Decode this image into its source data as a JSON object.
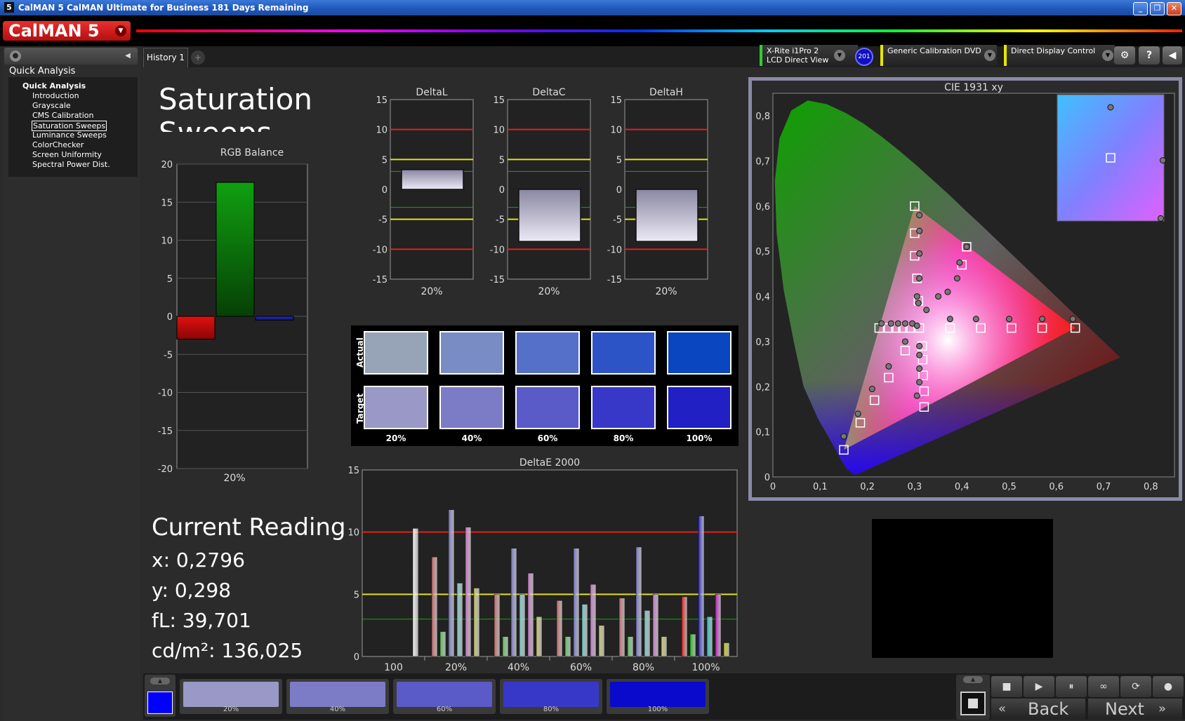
{
  "window": {
    "title": "CalMAN 5 CalMAN Ultimate for Business 181 Days Remaining",
    "logo_text": "CalMAN 5",
    "controls": [
      "_",
      "❐",
      "✕"
    ]
  },
  "sidebar": {
    "section_label": "Quick Analysis",
    "tree_head": "Quick Analysis",
    "items": [
      {
        "label": "Introduction",
        "selected": false
      },
      {
        "label": "Grayscale",
        "selected": false
      },
      {
        "label": "CMS Calibration",
        "selected": false
      },
      {
        "label": "Saturation Sweeps",
        "selected": true
      },
      {
        "label": "Luminance Sweeps",
        "selected": false
      },
      {
        "label": "ColorChecker",
        "selected": false
      },
      {
        "label": "Screen Uniformity",
        "selected": false
      },
      {
        "label": "Spectral Power Dist.",
        "selected": false
      }
    ]
  },
  "tabs": [
    {
      "label": "History 1"
    }
  ],
  "tab_add": "+",
  "devices": {
    "meter_line1": "X-Rite i1Pro 2",
    "meter_line2": "LCD Direct View",
    "meter_badge": "201",
    "source": "Generic Calibration DVD",
    "display": "Direct Display Control",
    "meter_color": "#33cc33",
    "source_color": "#e6e600",
    "display_color": "#e6e600"
  },
  "page": {
    "title_line1": "Saturation",
    "title_line2": "Sweeps"
  },
  "rgb_balance": {
    "title": "RGB Balance",
    "ymin": -20,
    "ymax": 20,
    "yticks": [
      20,
      15,
      10,
      5,
      0,
      -5,
      -10,
      -15,
      -20
    ],
    "xlabel": "20%",
    "bars": [
      {
        "name": "R",
        "value": -3,
        "color": "#e01010"
      },
      {
        "name": "G",
        "value": 17.6,
        "color": "#10a010"
      },
      {
        "name": "B",
        "value": -0.5,
        "color": "#2030d0"
      }
    ]
  },
  "delta_charts": [
    {
      "title": "DeltaL",
      "value": 3.3,
      "xlabel": "20%"
    },
    {
      "title": "DeltaC",
      "value": -8.7,
      "xlabel": "20%"
    },
    {
      "title": "DeltaH",
      "value": -8.7,
      "xlabel": "20%"
    }
  ],
  "delta_axis": {
    "ymin": -15,
    "ymax": 15,
    "yticks": [
      15,
      10,
      5,
      0,
      -5,
      -10,
      -15
    ],
    "lines": [
      {
        "y": 10,
        "color": "#e02020"
      },
      {
        "y": 5,
        "color": "#e0e020"
      },
      {
        "y": 3,
        "color": "#20a020"
      },
      {
        "y": -3,
        "color": "#20a020"
      },
      {
        "y": -5,
        "color": "#e0e020"
      },
      {
        "y": -10,
        "color": "#e02020"
      }
    ]
  },
  "swatches": {
    "actual_label": "Actual",
    "target_label": "Target",
    "labels": [
      "20%",
      "40%",
      "60%",
      "80%",
      "100%"
    ],
    "actual_colors": [
      "#97a4b8",
      "#7a8cc4",
      "#5570c8",
      "#2c54c6",
      "#0a46c0"
    ],
    "target_colors": [
      "#9a98c6",
      "#7c7cc6",
      "#5a5ac8",
      "#3838c8",
      "#2020c4"
    ]
  },
  "current_reading": {
    "title": "Current Reading",
    "x": "x: 0,2796",
    "y": "y: 0,298",
    "fl": "fL: 39,701",
    "cdm2": "cd/m²: 136,025"
  },
  "chart_data": [
    {
      "type": "bar",
      "title": "DeltaE 2000",
      "categories": [
        "100",
        "20%",
        "40%",
        "60%",
        "80%",
        "100%"
      ],
      "ylim": [
        0,
        15
      ],
      "yticks": [
        15,
        10,
        5,
        0
      ],
      "series": [
        {
          "values": [
            10.3,
            8,
            5,
            4.5,
            4.7,
            4.8
          ],
          "color": "#c06060"
        },
        {
          "values": [
            null,
            2,
            1.6,
            1.6,
            1.6,
            1.8
          ],
          "color": "#50c050"
        },
        {
          "values": [
            null,
            11.8,
            8.7,
            8.7,
            8.8,
            11.3
          ],
          "color": "#7070c0"
        },
        {
          "values": [
            null,
            5.9,
            5,
            4.2,
            3.7,
            3.2
          ],
          "color": "#70c0c0"
        },
        {
          "values": [
            null,
            10.4,
            6.7,
            5.8,
            5,
            5
          ],
          "color": "#c070c0"
        },
        {
          "values": [
            null,
            5.5,
            3.2,
            2.5,
            1.6,
            1.1
          ],
          "color": "#c0c060"
        }
      ],
      "threshold_lines": [
        {
          "y": 10,
          "color": "#e02020"
        },
        {
          "y": 5,
          "color": "#e0e020"
        },
        {
          "y": 3,
          "color": "#20a020"
        }
      ]
    },
    {
      "type": "scatter",
      "title": "CIE 1931 xy",
      "xlim": [
        0,
        0.85
      ],
      "ylim": [
        0,
        0.85
      ],
      "xticks": [
        "0",
        "0,1",
        "0,2",
        "0,3",
        "0,4",
        "0,5",
        "0,6",
        "0,7",
        "0,8"
      ],
      "yticks": [
        "0,8",
        "0,7",
        "0,6",
        "0,5",
        "0,4",
        "0,3",
        "0,2",
        "0,1",
        "0"
      ],
      "target_gamut": [
        [
          0.64,
          0.33
        ],
        [
          0.3,
          0.6
        ],
        [
          0.15,
          0.06
        ]
      ],
      "white_point": [
        0.3127,
        0.329
      ],
      "series": [
        {
          "name": "targets",
          "points": [
            [
              0.64,
              0.33
            ],
            [
              0.57,
              0.33
            ],
            [
              0.505,
              0.33
            ],
            [
              0.44,
              0.33
            ],
            [
              0.375,
              0.33
            ],
            [
              0.3,
              0.6
            ],
            [
              0.3,
              0.54
            ],
            [
              0.3,
              0.49
            ],
            [
              0.305,
              0.44
            ],
            [
              0.308,
              0.39
            ],
            [
              0.41,
              0.51
            ],
            [
              0.4,
              0.47
            ],
            [
              0.15,
              0.06
            ],
            [
              0.185,
              0.12
            ],
            [
              0.215,
              0.17
            ],
            [
              0.245,
              0.22
            ],
            [
              0.28,
              0.28
            ],
            [
              0.32,
              0.155
            ],
            [
              0.32,
              0.19
            ],
            [
              0.318,
              0.225
            ],
            [
              0.317,
              0.26
            ],
            [
              0.316,
              0.29
            ],
            [
              0.225,
              0.33
            ],
            [
              0.245,
              0.33
            ],
            [
              0.26,
              0.33
            ],
            [
              0.275,
              0.33
            ],
            [
              0.29,
              0.33
            ],
            [
              0.31,
              0.33
            ]
          ]
        },
        {
          "name": "measured",
          "points": [
            [
              0.635,
              0.35
            ],
            [
              0.57,
              0.35
            ],
            [
              0.5,
              0.35
            ],
            [
              0.43,
              0.35
            ],
            [
              0.375,
              0.35
            ],
            [
              0.31,
              0.58
            ],
            [
              0.31,
              0.545
            ],
            [
              0.31,
              0.495
            ],
            [
              0.31,
              0.44
            ],
            [
              0.308,
              0.385
            ],
            [
              0.41,
              0.51
            ],
            [
              0.395,
              0.475
            ],
            [
              0.39,
              0.44
            ],
            [
              0.37,
              0.41
            ],
            [
              0.35,
              0.4
            ],
            [
              0.325,
              0.37
            ],
            [
              0.305,
              0.4
            ],
            [
              0.15,
              0.09
            ],
            [
              0.18,
              0.14
            ],
            [
              0.21,
              0.195
            ],
            [
              0.245,
              0.245
            ],
            [
              0.28,
              0.3
            ],
            [
              0.305,
              0.18
            ],
            [
              0.31,
              0.21
            ],
            [
              0.31,
              0.24
            ],
            [
              0.31,
              0.27
            ],
            [
              0.31,
              0.29
            ],
            [
              0.23,
              0.34
            ],
            [
              0.25,
              0.34
            ],
            [
              0.265,
              0.34
            ],
            [
              0.28,
              0.34
            ],
            [
              0.295,
              0.34
            ],
            [
              0.305,
              0.335
            ]
          ]
        }
      ],
      "inset_points": {
        "target": [
          [
            0.5,
            0.5
          ]
        ],
        "measured": [
          [
            0.5,
            0.1
          ],
          [
            0.99,
            0.52
          ],
          [
            0.97,
            0.98
          ]
        ]
      }
    }
  ],
  "bottom": {
    "swatches": [
      {
        "label": "20%",
        "color": "#9a98c6"
      },
      {
        "label": "40%",
        "color": "#7c7cc6"
      },
      {
        "label": "60%",
        "color": "#5a5ac8"
      },
      {
        "label": "80%",
        "color": "#3838c8"
      },
      {
        "label": "100%",
        "color": "#0a0acc"
      }
    ],
    "current_color": "#0000ff",
    "back_label": "Back",
    "next_label": "Next"
  }
}
